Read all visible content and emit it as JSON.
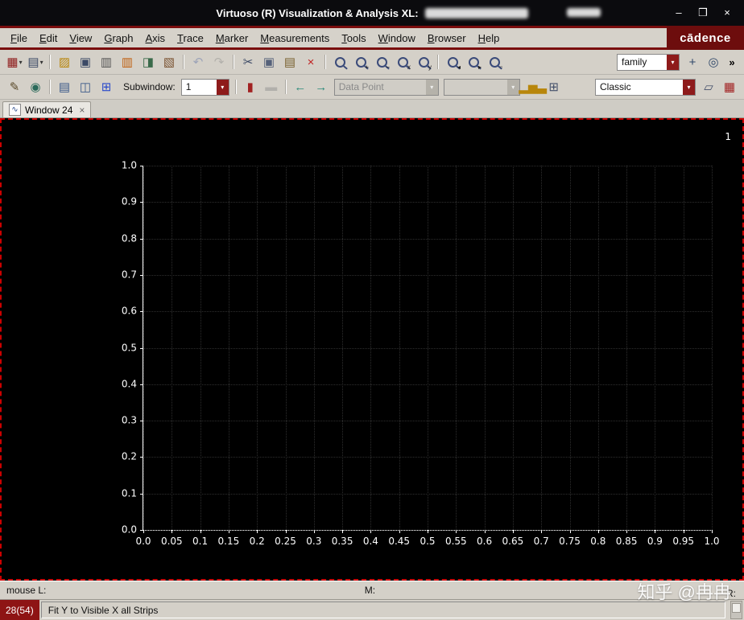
{
  "window": {
    "title": "Virtuoso (R) Visualization & Analysis XL:",
    "minimize": "–",
    "maximize": "❒",
    "close": "×"
  },
  "brand": {
    "logo": "cādence",
    "accent_red": "#7a0d0d"
  },
  "menu": {
    "items": [
      {
        "label": "File",
        "name": "menu-file"
      },
      {
        "label": "Edit",
        "name": "menu-edit"
      },
      {
        "label": "View",
        "name": "menu-view"
      },
      {
        "label": "Graph",
        "name": "menu-graph"
      },
      {
        "label": "Axis",
        "name": "menu-axis"
      },
      {
        "label": "Trace",
        "name": "menu-trace"
      },
      {
        "label": "Marker",
        "name": "menu-marker"
      },
      {
        "label": "Measurements",
        "name": "menu-measurements"
      },
      {
        "label": "Tools",
        "name": "menu-tools"
      },
      {
        "label": "Window",
        "name": "menu-window"
      },
      {
        "label": "Browser",
        "name": "menu-browser"
      },
      {
        "label": "Help",
        "name": "menu-help"
      }
    ]
  },
  "toolbar1": {
    "icons": [
      {
        "name": "new-window-icon",
        "glyph": "▦",
        "color": "#8e1b1b",
        "arrow": "▾"
      },
      {
        "name": "open-graph-icon",
        "glyph": "▤",
        "color": "#3c4a66",
        "arrow": "▾"
      },
      {
        "name": "separator",
        "sep": true
      },
      {
        "name": "open-file-icon",
        "glyph": "▨",
        "color": "#b8860b"
      },
      {
        "name": "save-icon",
        "glyph": "▣",
        "color": "#3c4a66"
      },
      {
        "name": "print-icon",
        "glyph": "▥",
        "color": "#555555"
      },
      {
        "name": "print-color-icon",
        "glyph": "▥",
        "color": "#c06010"
      },
      {
        "name": "snapshot-icon",
        "glyph": "◨",
        "color": "#3a6a4a"
      },
      {
        "name": "annotate-icon",
        "glyph": "▧",
        "color": "#7a5230"
      },
      {
        "name": "separator",
        "sep": true
      },
      {
        "name": "undo-icon",
        "glyph": "↶",
        "color": "#5b6fa5",
        "disabled": true
      },
      {
        "name": "redo-icon",
        "glyph": "↷",
        "color": "#8a8a8a",
        "disabled": true
      },
      {
        "name": "separator",
        "sep": true
      },
      {
        "name": "cut-icon",
        "glyph": "✂",
        "color": "#3c4a66"
      },
      {
        "name": "copy-icon",
        "glyph": "▣",
        "color": "#55617a"
      },
      {
        "name": "paste-icon",
        "glyph": "▤",
        "color": "#7a6230"
      },
      {
        "name": "delete-icon",
        "glyph": "×",
        "color": "#c02222"
      },
      {
        "name": "separator",
        "sep": true
      },
      {
        "name": "zoom-fit-icon",
        "cls": "mag"
      },
      {
        "name": "zoom-in-icon",
        "cls": "mag",
        "sub": "+"
      },
      {
        "name": "zoom-out-icon",
        "cls": "mag",
        "sub": "−"
      },
      {
        "name": "zoom-x-icon",
        "cls": "mag",
        "sub": "x"
      },
      {
        "name": "zoom-y-icon",
        "cls": "mag",
        "sub": "y"
      },
      {
        "name": "separator",
        "sep": true
      },
      {
        "name": "zoom-prev-icon",
        "cls": "mag",
        "sub": "◂"
      },
      {
        "name": "zoom-next-icon",
        "cls": "mag",
        "sub": "▸"
      },
      {
        "name": "zoom-box-icon",
        "cls": "mag",
        "sub": "▫"
      }
    ],
    "family_combo": {
      "value": "family"
    },
    "right_icons": [
      {
        "name": "crosshair-icon",
        "glyph": "+",
        "color": "#30486a"
      },
      {
        "name": "target-icon",
        "glyph": "◎",
        "color": "#30486a"
      }
    ],
    "overflow": "»"
  },
  "toolbar2": {
    "left_icons": [
      {
        "name": "calibrate-icon",
        "glyph": "✎",
        "color": "#5a4a2a"
      },
      {
        "name": "browser-eye-icon",
        "glyph": "◉",
        "color": "#2a6a5a"
      },
      {
        "name": "separator",
        "sep": true
      },
      {
        "name": "strip-mode-icon",
        "glyph": "▤",
        "color": "#3c5a8a"
      },
      {
        "name": "split-view-icon",
        "glyph": "◫",
        "color": "#3c5a8a"
      },
      {
        "name": "subwindow-grid-icon",
        "glyph": "⊞",
        "color": "#2a4aca"
      }
    ],
    "subwindow_label": "Subwindow:",
    "subwindow_value": "1",
    "mid_icons": [
      {
        "name": "separator",
        "sep": true
      },
      {
        "name": "vertical-marker-icon",
        "glyph": "▮",
        "color": "#a22222"
      },
      {
        "name": "horizontal-marker-icon",
        "glyph": "▬",
        "color": "#8a8a8a",
        "disabled": true
      },
      {
        "name": "separator",
        "sep": true
      },
      {
        "name": "prev-point-icon",
        "glyph": "←",
        "color": "#2a8a7a"
      },
      {
        "name": "next-point-icon",
        "glyph": "→",
        "color": "#2a8a7a"
      }
    ],
    "datapoint_value": "Data Point",
    "aux_value": "",
    "view_icons": [
      {
        "name": "histogram-icon",
        "glyph": "▂▅▃",
        "color": "#b8860b"
      },
      {
        "name": "table-icon",
        "glyph": "⊞",
        "color": "#44506a"
      }
    ],
    "classic_value": "Classic",
    "right_icons": [
      {
        "name": "cascade-windows-icon",
        "glyph": "▱",
        "color": "#44506a"
      },
      {
        "name": "workspace-icon",
        "glyph": "▦",
        "color": "#a22222"
      }
    ]
  },
  "tab": {
    "icon": "∿",
    "label": "Window 24",
    "close": "×"
  },
  "chart_data": {
    "type": "line",
    "title": "",
    "strip_label": "1",
    "series": [],
    "xlim": [
      0,
      1
    ],
    "ylim": [
      0,
      1
    ],
    "x_ticks": [
      "0.0",
      "0.05",
      "0.1",
      "0.15",
      "0.2",
      "0.25",
      "0.3",
      "0.35",
      "0.4",
      "0.45",
      "0.5",
      "0.55",
      "0.6",
      "0.65",
      "0.7",
      "0.75",
      "0.8",
      "0.85",
      "0.9",
      "0.95",
      "1.0"
    ],
    "y_ticks": [
      "0.0",
      "0.1",
      "0.2",
      "0.3",
      "0.4",
      "0.5",
      "0.6",
      "0.7",
      "0.8",
      "0.9",
      "1.0"
    ],
    "grid": "dotted",
    "background": "#000000",
    "axis_color": "#ffffff",
    "grid_color": "#2e2e2e"
  },
  "status": {
    "mouse_l": "mouse L:",
    "mouse_m": "M:",
    "mouse_r": "R:",
    "badge": "28(54)",
    "message": "Fit Y to Visible X all Strips"
  },
  "watermark": "知乎 @冉冉"
}
